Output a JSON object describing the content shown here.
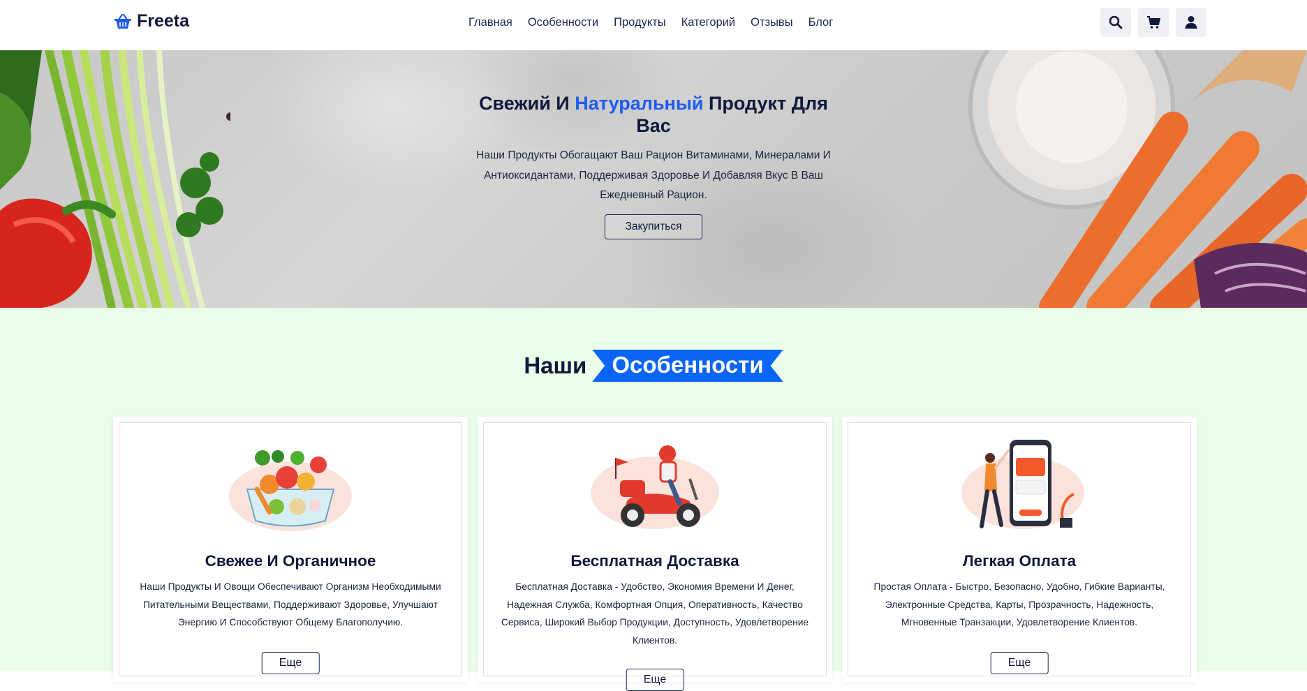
{
  "header": {
    "brand": "Freeta",
    "nav": [
      "Главная",
      "Особенности",
      "Продукты",
      "Категорий",
      "Отзывы",
      "Блог"
    ],
    "icons": [
      "search-icon",
      "cart-icon",
      "user-icon"
    ]
  },
  "hero": {
    "title_part1": "Свежий И ",
    "title_accent": "Натуральный",
    "title_part2": " Продукт Для Вас",
    "text": "Наши Продукты Обогащают Ваш Рацион Витаминами, Минералами И Антиоксидантами, Поддерживая Здоровье И Добавляя Вкус В Ваш Ежедневный Рацион.",
    "button": "Закупиться"
  },
  "features": {
    "title_plain": "Наши",
    "title_banner": "Особенности",
    "cards": [
      {
        "title": "Свежее И Органичное",
        "text": "Наши Продукты И Овощи Обеспечивают Организм Необходимыми Питательными Веществами, Поддерживают Здоровье, Улучшают Энергию И Способствуют Общему Благополучию.",
        "button": "Еще"
      },
      {
        "title": "Бесплатная Доставка",
        "text": "Бесплатная Доставка - Удобство, Экономия Времени И Денег, Надежная Служба, Комфортная Опция, Оперативность, Качество Сервиса, Широкий Выбор Продукции, Доступность, Удовлетворение Клиентов.",
        "button": "Еще"
      },
      {
        "title": "Легкая Оплата",
        "text": "Простая Оплата - Быстро, Безопасно, Удобно, Гибкие Варианты, Электронные Средства, Карты, Прозрачность, Надежность, Мгновенные Транзакции, Удовлетворение Клиентов.",
        "button": "Еще"
      }
    ]
  },
  "colors": {
    "accent": "#1f5cf0",
    "banner": "#0a64f5",
    "navy": "#11183c",
    "features_bg": "#e9fde8"
  }
}
